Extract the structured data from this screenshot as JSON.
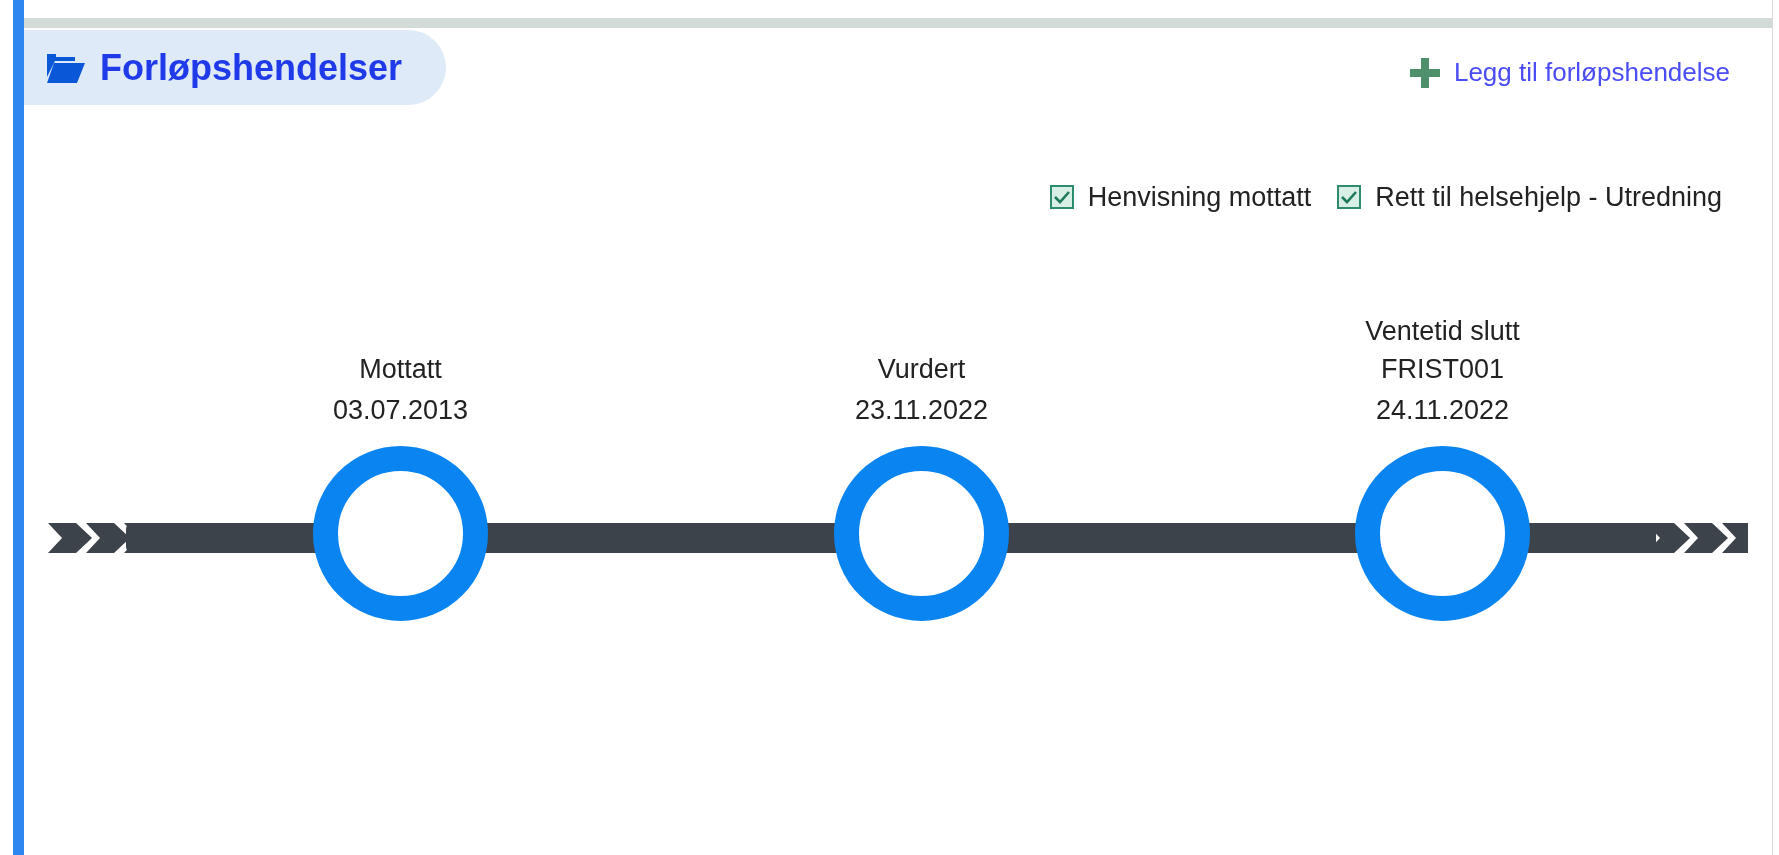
{
  "panel": {
    "title": "Forløpshendelser",
    "add_link": "Legg til forløpshendelse"
  },
  "filters": [
    {
      "label": "Henvisning mottatt",
      "checked": true
    },
    {
      "label": "Rett til helsehjelp - Utredning",
      "checked": true
    }
  ],
  "events": [
    {
      "title": "Mottatt",
      "date": "03.07.2013"
    },
    {
      "title": "Vurdert",
      "date": "23.11.2022"
    },
    {
      "title": "Ventetid slutt",
      "code": "FRIST001",
      "date": "24.11.2022"
    }
  ]
}
